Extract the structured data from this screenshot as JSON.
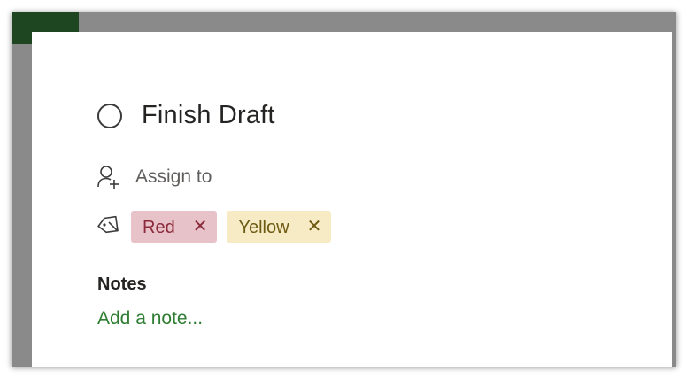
{
  "task": {
    "title": "Finish Draft",
    "completed": false
  },
  "assign": {
    "label": "Assign to",
    "icon": "person-add-icon"
  },
  "labels": {
    "icon": "tag-icon",
    "items": [
      {
        "name": "Red",
        "color": "#e8c2c9",
        "text_color": "#8a2a3a",
        "remove_glyph": "✕"
      },
      {
        "name": "Yellow",
        "color": "#f7ebc5",
        "text_color": "#6d5a12",
        "remove_glyph": "✕"
      }
    ]
  },
  "notes": {
    "heading": "Notes",
    "placeholder": "Add a note..."
  },
  "colors": {
    "accent_green": "#2e7d32",
    "header_strip": "#1e4620"
  }
}
